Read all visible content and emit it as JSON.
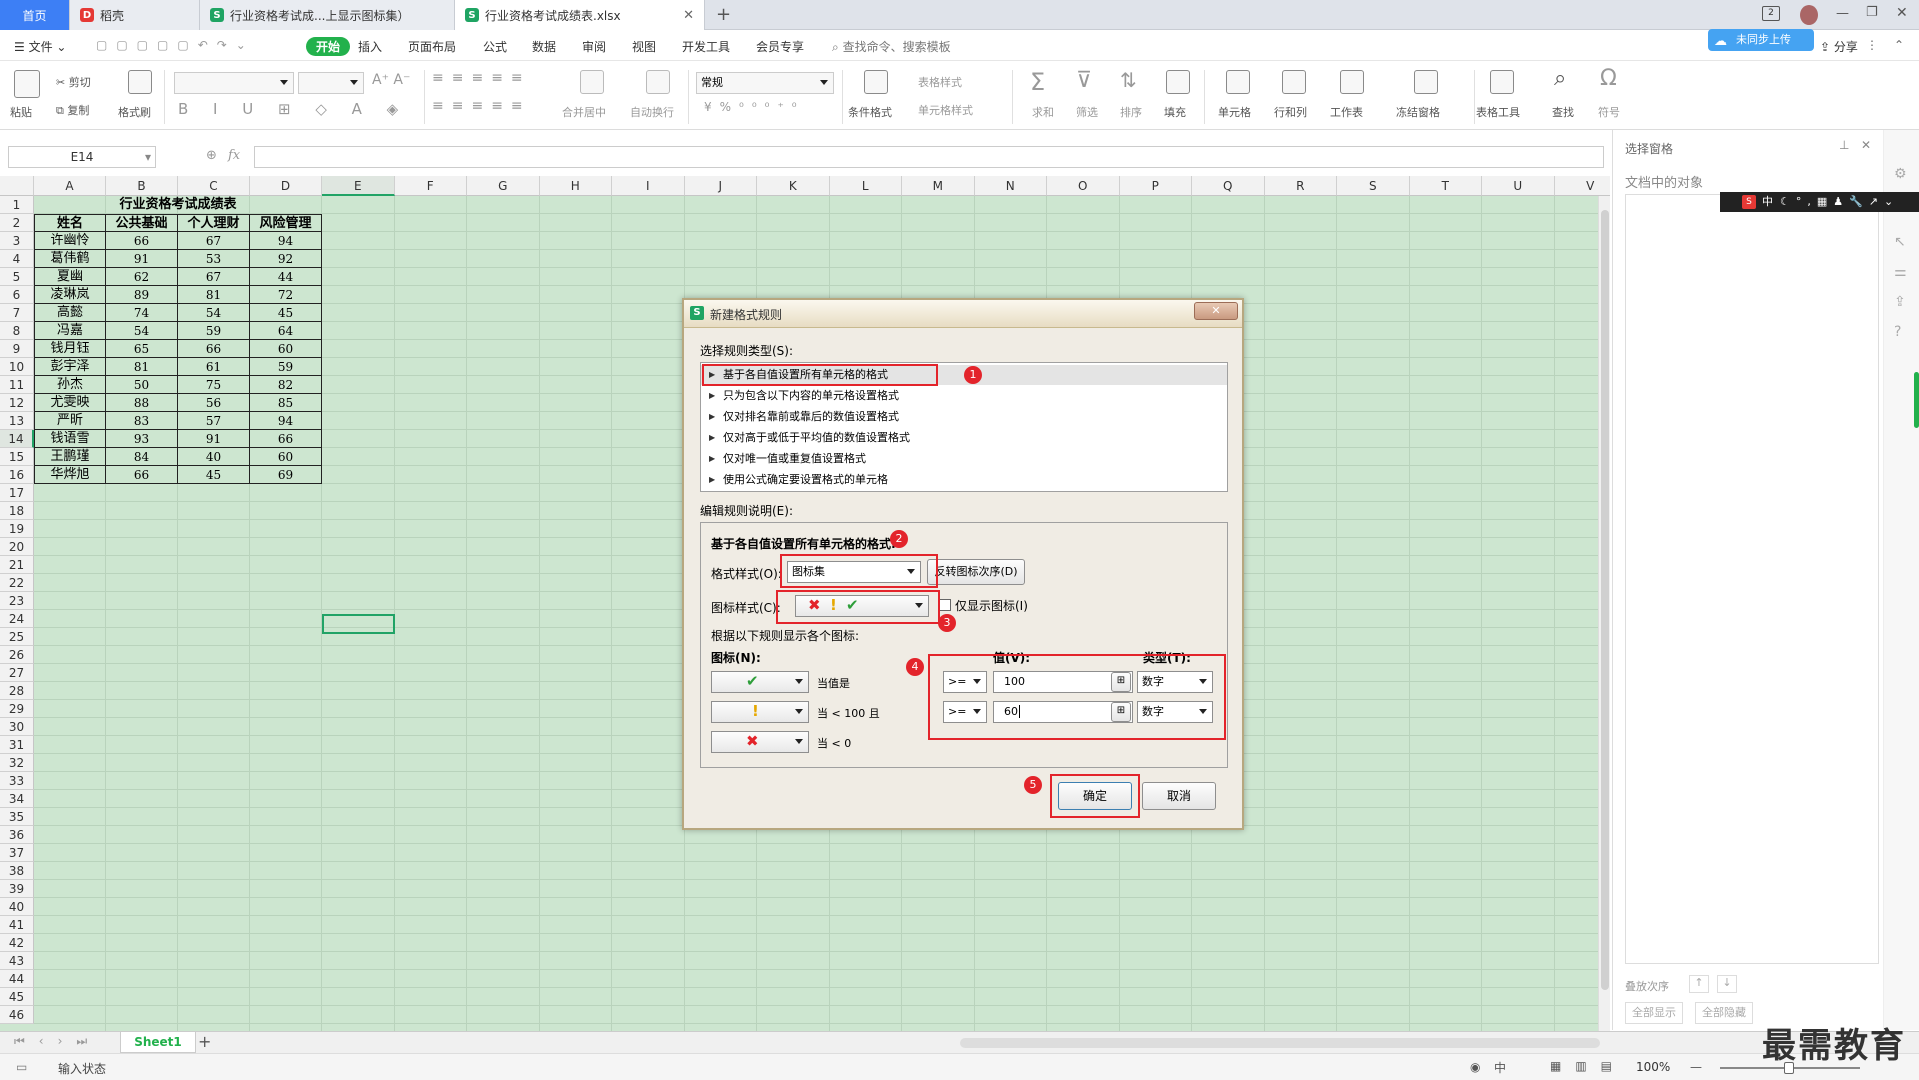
{
  "tabs": {
    "home": "首页",
    "daoke": "稻壳",
    "file1": "行业资格考试成...上显示图标集）",
    "file2": "行业资格考试成绩表.xlsx",
    "add": "+"
  },
  "window": {
    "badge": "2"
  },
  "menu": {
    "file": "文件",
    "items": [
      "开始",
      "插入",
      "页面布局",
      "公式",
      "数据",
      "审阅",
      "视图",
      "开发工具",
      "会员专享"
    ],
    "search": "查找命令、搜索模板",
    "share": "分享",
    "cloud": "未同步上传"
  },
  "ribbon": {
    "paste": "粘贴",
    "cut": "剪切",
    "copy": "复制",
    "format_painter": "格式刷",
    "merge": "合并居中",
    "wrap": "自动换行",
    "number_format": "常规",
    "cond_format": "条件格式",
    "table_style": "表格样式",
    "cell_style": "单元格样式",
    "sum": "求和",
    "filter": "筛选",
    "sort": "排序",
    "fill": "填充",
    "cell": "单元格",
    "rowcol": "行和列",
    "sheet": "工作表",
    "freeze": "冻结窗格",
    "table_tools": "表格工具",
    "find": "查找",
    "symbol": "符号"
  },
  "formula_bar": {
    "name_box": "E14",
    "fx": "fx"
  },
  "columns": [
    "A",
    "B",
    "C",
    "D",
    "E",
    "F",
    "G",
    "H",
    "I",
    "J",
    "K",
    "L",
    "M",
    "N",
    "O",
    "P",
    "Q",
    "R",
    "S",
    "T",
    "U",
    "V"
  ],
  "sheet": {
    "title": "行业资格考试成绩表",
    "headers": [
      "姓名",
      "公共基础",
      "个人理财",
      "风险管理"
    ],
    "rows": [
      [
        "许幽怜",
        "66",
        "67",
        "94"
      ],
      [
        "葛伟鹤",
        "91",
        "53",
        "92"
      ],
      [
        "夏幽",
        "62",
        "67",
        "44"
      ],
      [
        "凌琳岚",
        "89",
        "81",
        "72"
      ],
      [
        "高懿",
        "74",
        "54",
        "45"
      ],
      [
        "冯嘉",
        "54",
        "59",
        "64"
      ],
      [
        "钱月钰",
        "65",
        "66",
        "60"
      ],
      [
        "彭宇泽",
        "81",
        "61",
        "59"
      ],
      [
        "孙杰",
        "50",
        "75",
        "82"
      ],
      [
        "尤雯映",
        "88",
        "56",
        "85"
      ],
      [
        "严昕",
        "83",
        "57",
        "94"
      ],
      [
        "钱语雪",
        "93",
        "91",
        "66"
      ],
      [
        "王鹏瑾",
        "84",
        "40",
        "60"
      ],
      [
        "华烨旭",
        "66",
        "45",
        "69"
      ]
    ]
  },
  "sheet_tab": "Sheet1",
  "status": {
    "mode": "输入状态",
    "zoom": "100%",
    "lang": "中"
  },
  "right_pane": {
    "title": "选择窗格",
    "subtitle": "文档中的对象",
    "order": "叠放次序",
    "show_all": "全部显示",
    "hide_all": "全部隐藏"
  },
  "ime": {
    "label": "中"
  },
  "dialog": {
    "title": "新建格式规则",
    "close": "✕",
    "select_type_label": "选择规则类型(S):",
    "rule_types": [
      "基于各自值设置所有单元格的格式",
      "只为包含以下内容的单元格设置格式",
      "仅对排名靠前或靠后的数值设置格式",
      "仅对高于或低于平均值的数值设置格式",
      "仅对唯一值或重复值设置格式",
      "使用公式确定要设置格式的单元格"
    ],
    "edit_desc_label": "编辑规则说明(E):",
    "section_title": "基于各自值设置所有单元格的格式:",
    "format_style_label": "格式样式(O):",
    "format_style_value": "图标集",
    "reverse_button": "反转图标次序(D)",
    "icon_style_label": "图标样式(C):",
    "show_icon_only": "仅显示图标(I)",
    "rule_desc": "根据以下规则显示各个图标:",
    "icon_header": "图标(N):",
    "value_header": "值(V):",
    "type_header": "类型(T):",
    "rules": [
      {
        "icon": "check",
        "cond": "当值是",
        "op": ">=",
        "value": "100",
        "type": "数字"
      },
      {
        "icon": "exclaim",
        "cond": "当 < 100 且",
        "op": ">=",
        "value": "60",
        "type": "数字"
      },
      {
        "icon": "cross",
        "cond": "当 < 0"
      }
    ],
    "ok": "确定",
    "cancel": "取消",
    "markers": [
      "1",
      "2",
      "3",
      "4",
      "5"
    ]
  },
  "watermark": "最需教育"
}
